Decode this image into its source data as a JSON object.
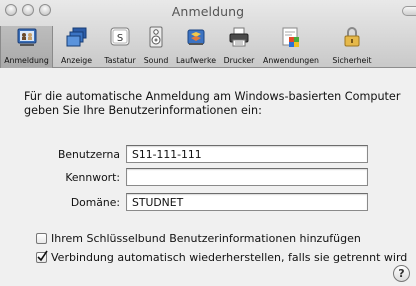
{
  "window": {
    "title": "Anmeldung"
  },
  "toolbar": {
    "items": [
      {
        "label": "Anmeldung",
        "icon": "login-icon",
        "selected": true
      },
      {
        "label": "Anzeige",
        "icon": "display-icon",
        "selected": false
      },
      {
        "label": "Tastatur",
        "icon": "keyboard-icon",
        "selected": false
      },
      {
        "label": "Sound",
        "icon": "speaker-icon",
        "selected": false
      },
      {
        "label": "Laufwerke",
        "icon": "drives-icon",
        "selected": false
      },
      {
        "label": "Drucker",
        "icon": "printer-icon",
        "selected": false
      },
      {
        "label": "Anwendungen",
        "icon": "applications-icon",
        "selected": false
      },
      {
        "label": "Sicherheit",
        "icon": "lock-icon",
        "selected": false
      }
    ]
  },
  "form": {
    "intro": "Für die automatische Anmeldung am Windows-basierten Computer geben Sie Ihre Benutzerinformationen ein:",
    "username_label": "Benutzerna",
    "username_value": "S11-111-111",
    "password_label": "Kennwort:",
    "password_value": "",
    "domain_label": "Domäne:",
    "domain_value": "STUDNET"
  },
  "options": {
    "keychain_label": "Ihrem Schlüsselbund Benutzerinformationen hinzufügen",
    "keychain_checked": false,
    "reconnect_label": "Verbindung automatisch wiederherstellen, falls sie getrennt wird",
    "reconnect_checked": true
  },
  "help": {
    "label": "?"
  }
}
